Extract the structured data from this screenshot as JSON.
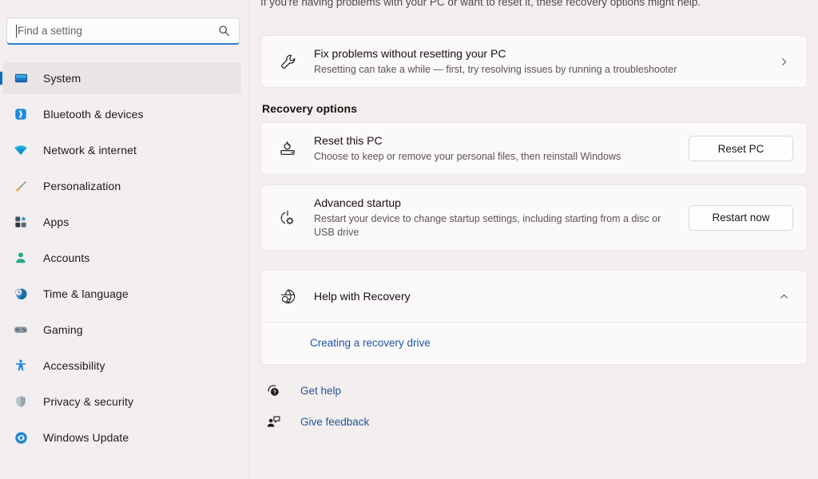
{
  "sidebar": {
    "search": {
      "placeholder": "Find a setting",
      "value": "",
      "icon": "search-icon"
    },
    "items": [
      {
        "label": "System",
        "icon": "monitor-icon",
        "selected": true
      },
      {
        "label": "Bluetooth & devices",
        "icon": "bluetooth-icon",
        "selected": false
      },
      {
        "label": "Network & internet",
        "icon": "wifi-icon",
        "selected": false
      },
      {
        "label": "Personalization",
        "icon": "paintbrush-icon",
        "selected": false
      },
      {
        "label": "Apps",
        "icon": "apps-grid-icon",
        "selected": false
      },
      {
        "label": "Accounts",
        "icon": "person-icon",
        "selected": false
      },
      {
        "label": "Time & language",
        "icon": "clock-globe-icon",
        "selected": false
      },
      {
        "label": "Gaming",
        "icon": "gamepad-icon",
        "selected": false
      },
      {
        "label": "Accessibility",
        "icon": "accessibility-person-icon",
        "selected": false
      },
      {
        "label": "Privacy & security",
        "icon": "shield-icon",
        "selected": false
      },
      {
        "label": "Windows Update",
        "icon": "update-refresh-icon",
        "selected": false
      }
    ]
  },
  "main": {
    "intro": "If you're having problems with your PC or want to reset it, these recovery options might help.",
    "fix_problems": {
      "title": "Fix problems without resetting your PC",
      "subtitle": "Resetting can take a while — first, try resolving issues by running a troubleshooter",
      "icon": "wrench-icon",
      "chevron": "chevron-right-icon"
    },
    "section_title": "Recovery options",
    "reset_pc": {
      "title": "Reset this PC",
      "subtitle": "Choose to keep or remove your personal files, then reinstall Windows",
      "icon": "pc-reset-icon",
      "button": "Reset PC"
    },
    "advanced_startup": {
      "title": "Advanced startup",
      "subtitle": "Restart your device to change startup settings, including starting from a disc or USB drive",
      "icon": "power-gear-icon",
      "button": "Restart now"
    },
    "help_expander": {
      "title": "Help with Recovery",
      "icon": "globe-search-icon",
      "chevron": "chevron-up-icon",
      "expanded": true,
      "links": [
        {
          "label": "Creating a recovery drive"
        }
      ]
    },
    "footer": [
      {
        "label": "Get help",
        "icon": "help-question-icon"
      },
      {
        "label": "Give feedback",
        "icon": "feedback-person-icon"
      }
    ]
  },
  "colors": {
    "page_background": "#f3efee",
    "card_background": "#fbf9f9",
    "accent_selection": "#0f6cbd",
    "link": "#23559f",
    "search_focus_underline": "#2d7dd2"
  }
}
